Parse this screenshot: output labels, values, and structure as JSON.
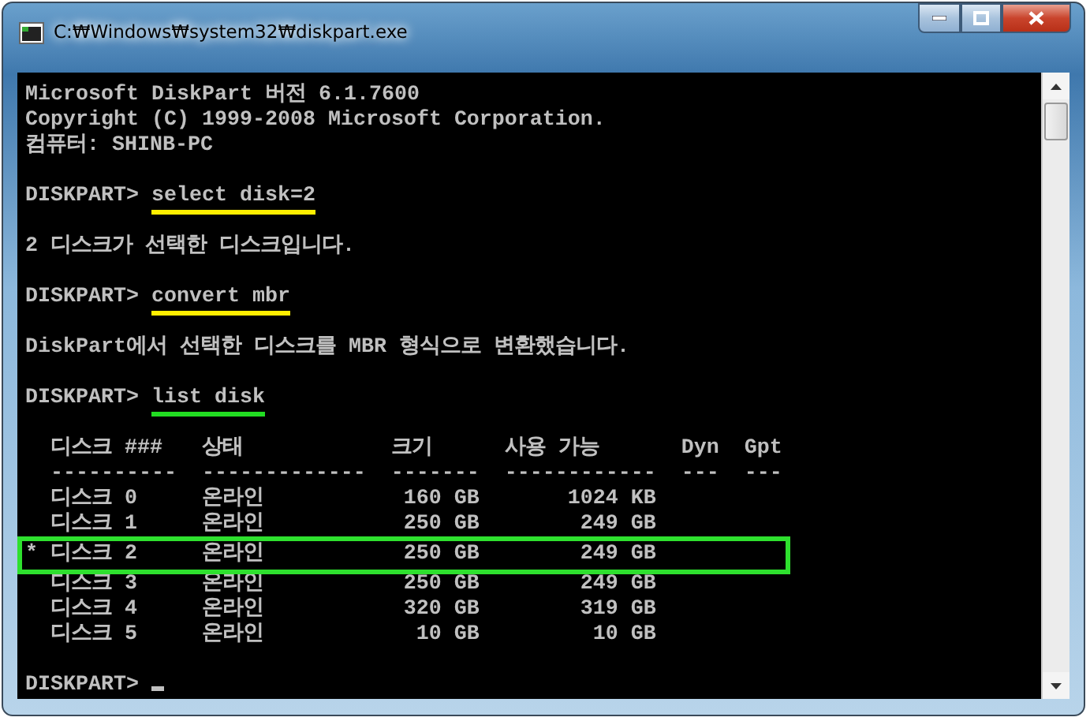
{
  "window": {
    "title": "C:₩Windows₩system32₩diskpart.exe"
  },
  "console": {
    "lines": [
      {
        "kind": "text",
        "text": "Microsoft DiskPart 버전 6.1.7600"
      },
      {
        "kind": "text",
        "text": "Copyright (C) 1999-2008 Microsoft Corporation."
      },
      {
        "kind": "text",
        "text": "컴퓨터: SHINB-PC"
      },
      {
        "kind": "blank"
      },
      {
        "kind": "command",
        "prompt": "DISKPART>",
        "command": "select disk=2",
        "color": "#ffee00"
      },
      {
        "kind": "blank"
      },
      {
        "kind": "text",
        "text": "2 디스크가 선택한 디스크입니다."
      },
      {
        "kind": "blank"
      },
      {
        "kind": "command",
        "prompt": "DISKPART>",
        "command": "convert mbr",
        "color": "#ffee00"
      },
      {
        "kind": "blank"
      },
      {
        "kind": "text",
        "text": "DiskPart에서 선택한 디스크를 MBR 형식으로 변환했습니다."
      },
      {
        "kind": "blank"
      },
      {
        "kind": "command",
        "prompt": "DISKPART>",
        "command": "list disk",
        "color": "#22dd22"
      },
      {
        "kind": "blank"
      }
    ],
    "table": {
      "columns": [
        {
          "label": "디스크 ###",
          "rule": "----------"
        },
        {
          "label": "상태",
          "rule": "-------------"
        },
        {
          "label": "크기",
          "rule": "-------"
        },
        {
          "label": "사용 가능",
          "rule": "------------"
        },
        {
          "label": "Dyn",
          "rule": "---"
        },
        {
          "label": "Gpt",
          "rule": "---"
        }
      ],
      "rows": [
        {
          "marker": "",
          "disk": "디스크 0",
          "status": "온라인",
          "size": "160 GB",
          "free": "1024 KB",
          "selected": false
        },
        {
          "marker": "",
          "disk": "디스크 1",
          "status": "온라인",
          "size": "250 GB",
          "free": "249 GB",
          "selected": false
        },
        {
          "marker": "*",
          "disk": "디스크 2",
          "status": "온라인",
          "size": "250 GB",
          "free": "249 GB",
          "selected": true
        },
        {
          "marker": "",
          "disk": "디스크 3",
          "status": "온라인",
          "size": "250 GB",
          "free": "249 GB",
          "selected": false
        },
        {
          "marker": "",
          "disk": "디스크 4",
          "status": "온라인",
          "size": "320 GB",
          "free": "319 GB",
          "selected": false
        },
        {
          "marker": "",
          "disk": "디스크 5",
          "status": "온라인",
          "size": "10 GB",
          "free": "10 GB",
          "selected": false
        }
      ]
    },
    "prompt": "DISKPART>"
  }
}
